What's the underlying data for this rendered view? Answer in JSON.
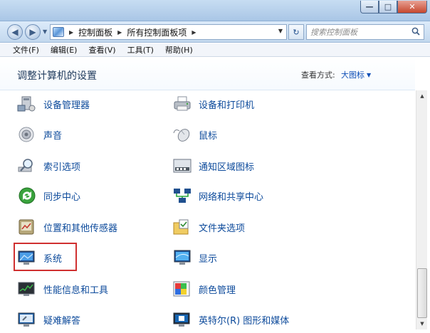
{
  "window": {
    "minimize_label": "—",
    "maximize_label": "□",
    "close_label": "✕"
  },
  "nav": {
    "back_icon": "back-arrow-icon",
    "forward_icon": "forward-arrow-icon",
    "breadcrumbs": [
      "控制面板",
      "所有控制面板项"
    ],
    "search_placeholder": "搜索控制面板"
  },
  "menu": [
    "文件(F)",
    "编辑(E)",
    "查看(V)",
    "工具(T)",
    "帮助(H)"
  ],
  "header": {
    "title": "调整计算机的设置",
    "view_by_label": "查看方式:",
    "view_by_value": "大图标"
  },
  "items_left": [
    {
      "label": "设备管理器",
      "icon": "device-manager-icon"
    },
    {
      "label": "声音",
      "icon": "speaker-icon"
    },
    {
      "label": "索引选项",
      "icon": "indexing-icon"
    },
    {
      "label": "同步中心",
      "icon": "sync-center-icon"
    },
    {
      "label": "位置和其他传感器",
      "icon": "sensor-icon"
    },
    {
      "label": "系统",
      "icon": "system-icon"
    },
    {
      "label": "性能信息和工具",
      "icon": "performance-icon"
    },
    {
      "label": "疑难解答",
      "icon": "troubleshoot-icon"
    }
  ],
  "items_right": [
    {
      "label": "设备和打印机",
      "icon": "printer-icon"
    },
    {
      "label": "鼠标",
      "icon": "mouse-icon"
    },
    {
      "label": "通知区域图标",
      "icon": "notification-area-icon"
    },
    {
      "label": "网络和共享中心",
      "icon": "network-icon"
    },
    {
      "label": "文件夹选项",
      "icon": "folder-options-icon"
    },
    {
      "label": "显示",
      "icon": "display-icon"
    },
    {
      "label": "颜色管理",
      "icon": "color-management-icon"
    },
    {
      "label": "英特尔(R) 图形和媒体",
      "icon": "intel-graphics-icon"
    }
  ],
  "colors": {
    "link": "#0c4a9b",
    "highlight_box": "#d03030",
    "title": "#1e395b"
  }
}
